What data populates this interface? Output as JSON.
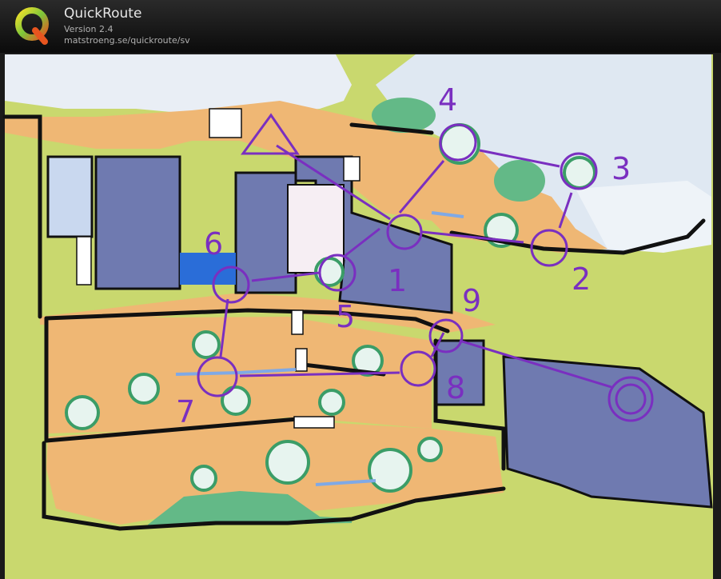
{
  "app": {
    "title": "QuickRoute",
    "version": "Version 2.4",
    "url": "matstroeng.se/quickroute/sv",
    "logo_letter": "Q"
  },
  "map": {
    "course_color": "#8a2be2",
    "control_numbers": [
      "1",
      "2",
      "3",
      "4",
      "5",
      "6",
      "7",
      "8",
      "9"
    ]
  }
}
